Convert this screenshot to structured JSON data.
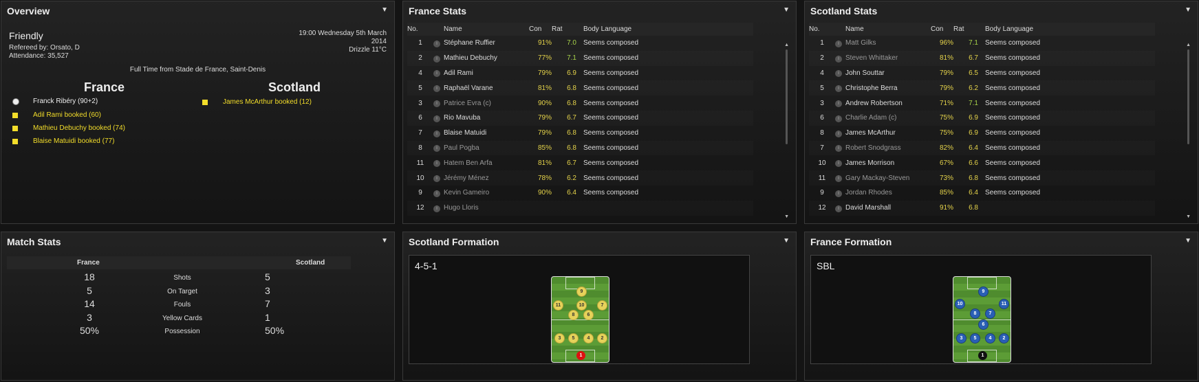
{
  "overview": {
    "title": "Overview",
    "match_type": "Friendly",
    "referee": "Refereed by: Orsato, D",
    "attendance": "Attendance: 35,527",
    "datetime_line1": "19:00 Wednesday 5th March",
    "datetime_line2": "2014",
    "weather": "Drizzle 11°C",
    "full_time": "Full Time from Stade de France, Saint-Denis",
    "home_team": "France",
    "away_team": "Scotland",
    "home_events": [
      {
        "icon": "ball-icon",
        "text": "Franck Ribéry (90+2)"
      },
      {
        "icon": "yellow-card-icon",
        "text": "Adil Rami booked (60)"
      },
      {
        "icon": "yellow-card-icon",
        "text": "Mathieu Debuchy booked (74)"
      },
      {
        "icon": "yellow-card-icon",
        "text": "Blaise Matuidi booked (77)"
      }
    ],
    "away_events": [
      {
        "icon": "yellow-card-icon",
        "text": "James McArthur booked (12)"
      }
    ]
  },
  "france_stats": {
    "title": "France Stats",
    "columns": [
      "No.",
      "Name",
      "Con",
      "Rat",
      "Body Language"
    ],
    "rows": [
      {
        "no": "1",
        "name": "Stéphane Ruffier",
        "con": "91%",
        "rat": "7.0",
        "bl": "Seems composed",
        "dim": false
      },
      {
        "no": "2",
        "name": "Mathieu Debuchy",
        "con": "77%",
        "rat": "7.1",
        "bl": "Seems composed",
        "dim": false
      },
      {
        "no": "4",
        "name": "Adil Rami",
        "con": "79%",
        "rat": "6.9",
        "bl": "Seems composed",
        "dim": false
      },
      {
        "no": "5",
        "name": "Raphaël Varane",
        "con": "81%",
        "rat": "6.8",
        "bl": "Seems composed",
        "dim": false
      },
      {
        "no": "3",
        "name": "Patrice Evra (c)",
        "con": "90%",
        "rat": "6.8",
        "bl": "Seems composed",
        "dim": true
      },
      {
        "no": "6",
        "name": "Rio Mavuba",
        "con": "79%",
        "rat": "6.7",
        "bl": "Seems composed",
        "dim": false
      },
      {
        "no": "7",
        "name": "Blaise Matuidi",
        "con": "79%",
        "rat": "6.8",
        "bl": "Seems composed",
        "dim": false
      },
      {
        "no": "8",
        "name": "Paul Pogba",
        "con": "85%",
        "rat": "6.8",
        "bl": "Seems composed",
        "dim": true
      },
      {
        "no": "11",
        "name": "Hatem Ben Arfa",
        "con": "81%",
        "rat": "6.7",
        "bl": "Seems composed",
        "dim": true
      },
      {
        "no": "10",
        "name": "Jérémy Ménez",
        "con": "78%",
        "rat": "6.2",
        "bl": "Seems composed",
        "dim": true
      },
      {
        "no": "9",
        "name": "Kevin Gameiro",
        "con": "90%",
        "rat": "6.4",
        "bl": "Seems composed",
        "dim": true
      },
      {
        "no": "12",
        "name": "Hugo Lloris",
        "con": "",
        "rat": "",
        "bl": "",
        "dim": true
      }
    ]
  },
  "scotland_stats": {
    "title": "Scotland Stats",
    "columns": [
      "No.",
      "Name",
      "Con",
      "Rat",
      "Body Language"
    ],
    "rows": [
      {
        "no": "1",
        "name": "Matt Gilks",
        "con": "96%",
        "rat": "7.1",
        "bl": "Seems composed",
        "dim": true
      },
      {
        "no": "2",
        "name": "Steven Whittaker",
        "con": "81%",
        "rat": "6.7",
        "bl": "Seems composed",
        "dim": true
      },
      {
        "no": "4",
        "name": "John Souttar",
        "con": "79%",
        "rat": "6.5",
        "bl": "Seems composed",
        "dim": false
      },
      {
        "no": "5",
        "name": "Christophe Berra",
        "con": "79%",
        "rat": "6.2",
        "bl": "Seems composed",
        "dim": false
      },
      {
        "no": "3",
        "name": "Andrew Robertson",
        "con": "71%",
        "rat": "7.1",
        "bl": "Seems composed",
        "dim": false
      },
      {
        "no": "6",
        "name": "Charlie Adam (c)",
        "con": "75%",
        "rat": "6.9",
        "bl": "Seems composed",
        "dim": true
      },
      {
        "no": "8",
        "name": "James McArthur",
        "con": "75%",
        "rat": "6.9",
        "bl": "Seems composed",
        "dim": false
      },
      {
        "no": "7",
        "name": "Robert Snodgrass",
        "con": "82%",
        "rat": "6.4",
        "bl": "Seems composed",
        "dim": true
      },
      {
        "no": "10",
        "name": "James Morrison",
        "con": "67%",
        "rat": "6.6",
        "bl": "Seems composed",
        "dim": false
      },
      {
        "no": "11",
        "name": "Gary Mackay-Steven",
        "con": "73%",
        "rat": "6.8",
        "bl": "Seems composed",
        "dim": true
      },
      {
        "no": "9",
        "name": "Jordan Rhodes",
        "con": "85%",
        "rat": "6.4",
        "bl": "Seems composed",
        "dim": true
      },
      {
        "no": "12",
        "name": "David Marshall",
        "con": "91%",
        "rat": "6.8",
        "bl": "",
        "dim": false
      }
    ]
  },
  "match_stats": {
    "title": "Match Stats",
    "home": "France",
    "away": "Scotland",
    "rows": [
      {
        "label": "Shots",
        "home": "18",
        "away": "5"
      },
      {
        "label": "On Target",
        "home": "5",
        "away": "3"
      },
      {
        "label": "Fouls",
        "home": "14",
        "away": "7"
      },
      {
        "label": "Yellow Cards",
        "home": "3",
        "away": "1"
      },
      {
        "label": "Possession",
        "home": "50%",
        "away": "50%"
      }
    ]
  },
  "scotland_formation": {
    "title": "Scotland Formation",
    "shape": "4-5-1",
    "players": [
      "9",
      "11",
      "10",
      "7",
      "8",
      "6",
      "3",
      "5",
      "4",
      "2",
      "1"
    ]
  },
  "france_formation": {
    "title": "France Formation",
    "shape": "SBL",
    "players": [
      "9",
      "10",
      "11",
      "8",
      "7",
      "6",
      "3",
      "5",
      "4",
      "2",
      "1"
    ]
  },
  "colors": {
    "accent_yellow": "#f3dd2a",
    "rating_green": "#a7d24a",
    "scotland_kit": "#e6d25a",
    "france_kit": "#2a5fb5"
  }
}
